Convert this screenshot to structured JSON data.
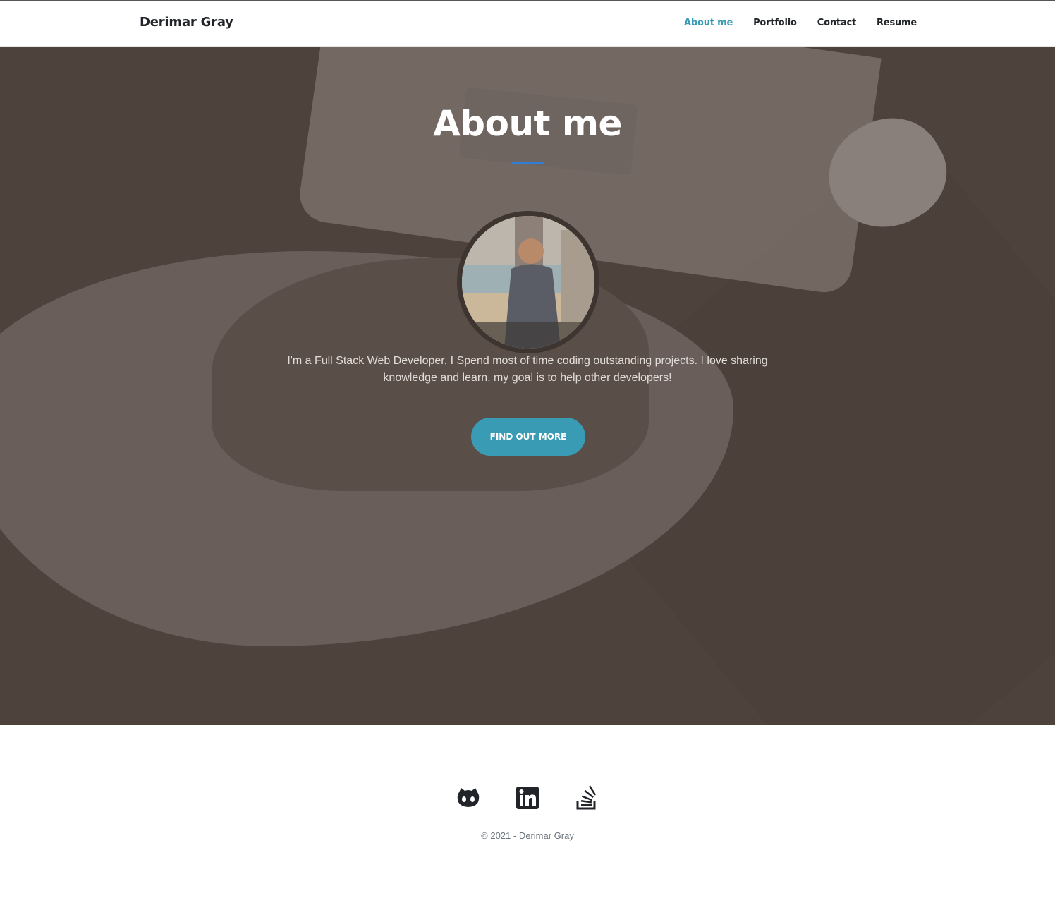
{
  "navbar": {
    "brand": "Derimar Gray",
    "links": [
      "About me",
      "Portfolio",
      "Contact",
      "Resume"
    ],
    "active": "About me"
  },
  "hero": {
    "title": "About me",
    "text": "I'm a Full Stack Web Developer, I Spend most of time coding outstanding projects. I love sharing knowledge and learn, my goal is to help other developers!",
    "cta": "FIND OUT MORE"
  },
  "footer": {
    "social": [
      "github-icon",
      "linkedin-icon",
      "stackoverflow-icon"
    ],
    "copyright": "© 2021 - Derimar Gray"
  },
  "colors": {
    "accent": "#3a9bb4",
    "rule": "#2f7fd8",
    "hero_overlay": "#4e423c"
  }
}
